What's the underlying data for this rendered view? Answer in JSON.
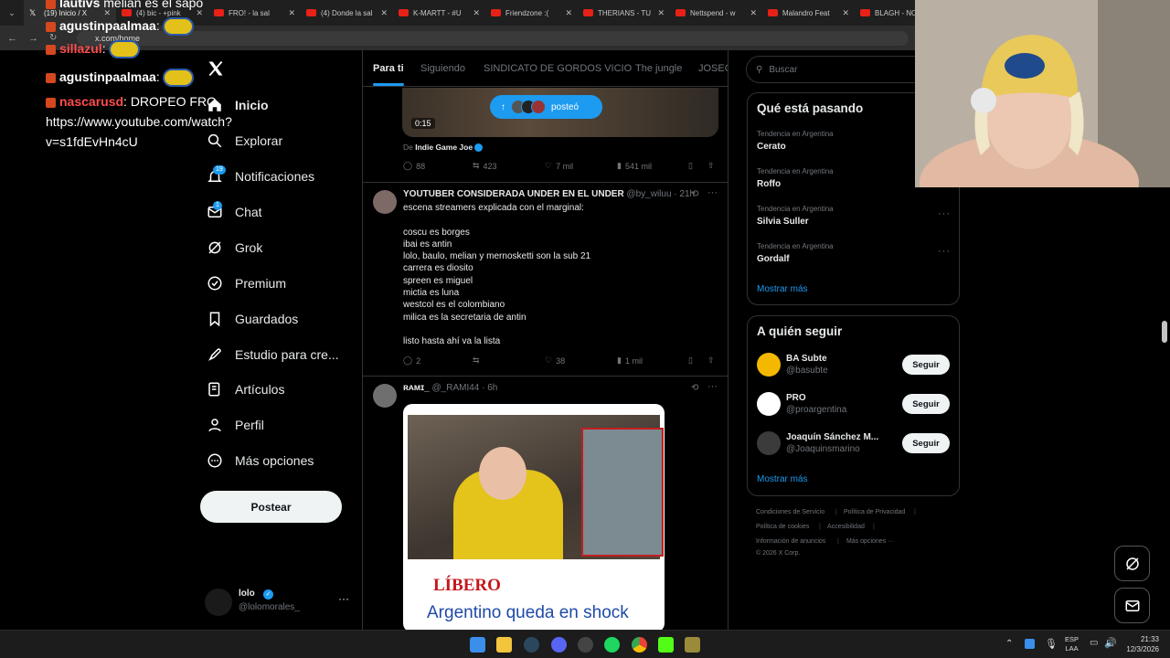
{
  "browser": {
    "tabs": [
      {
        "label": "(19) Inicio / X",
        "active": true,
        "favicon": "x-icon"
      },
      {
        "label": "(4) bic - +pink",
        "favicon": "youtube-icon"
      },
      {
        "label": "FRO! - la sal",
        "favicon": "youtube-icon"
      },
      {
        "label": "(4) Donde la sal",
        "favicon": "youtube-icon"
      },
      {
        "label": "K-MARTT - #U",
        "favicon": "youtube-icon"
      },
      {
        "label": "Friendzone :(",
        "favicon": "youtube-icon"
      },
      {
        "label": "THERIANS - TU",
        "favicon": "youtube-icon"
      },
      {
        "label": "Nettspend - w",
        "favicon": "youtube-icon"
      },
      {
        "label": "Malandro Feat",
        "favicon": "youtube-icon"
      },
      {
        "label": "BLAGH - NO",
        "favicon": "youtube-icon"
      }
    ],
    "url": "x.com/home"
  },
  "chat": [
    {
      "user": "lautivs",
      "text": " melian es el sapo",
      "color": "#ffffff"
    },
    {
      "user": "agustinpaalmaa",
      "text": ":",
      "color": "#ffffff",
      "emote": true
    },
    {
      "user": "sillazul",
      "text": ":",
      "color": "#ff4d4d",
      "emote": true
    },
    {
      "user": "agustinpaalmaa",
      "text": ":",
      "color": "#ffffff",
      "emote": true
    },
    {
      "user": "nascarusd",
      "text": ": DROPEO FRO https://www.youtube.com/watch?v=s1fdEvHn4cU",
      "color": "#ff4d4d"
    }
  ],
  "sidebar": {
    "items": [
      {
        "label": "Inicio",
        "icon": "home-icon",
        "bold": true
      },
      {
        "label": "Explorar",
        "icon": "search-icon"
      },
      {
        "label": "Notificaciones",
        "icon": "bell-icon",
        "badge": "19"
      },
      {
        "label": "Chat",
        "icon": "mail-icon",
        "badge": "1"
      },
      {
        "label": "Grok",
        "icon": "grok-icon"
      },
      {
        "label": "Premium",
        "icon": "premium-icon"
      },
      {
        "label": "Guardados",
        "icon": "bookmark-icon"
      },
      {
        "label": "Estudio para cre...",
        "icon": "rocket-icon"
      },
      {
        "label": "Artículos",
        "icon": "article-icon"
      },
      {
        "label": "Perfil",
        "icon": "person-icon"
      },
      {
        "label": "Más opciones",
        "icon": "more-circle-icon"
      }
    ],
    "post_label": "Postear",
    "account": {
      "name": "lolo",
      "handle": "@lolomorales_"
    }
  },
  "feed": {
    "tabs": [
      "Para ti",
      "Siguiendo",
      "SINDICATO DE GORDOS VICIO",
      "The jungle",
      "JOSEO"
    ],
    "tweet1": {
      "duration": "0:15",
      "posted_label": "posteó",
      "from_prefix": "De",
      "from_name": "Indie Game Joe",
      "replies": "88",
      "retweets": "423",
      "likes": "7 mil",
      "views": "541 mil"
    },
    "tweet2": {
      "name": "YOUTUBER CONSIDERADA UNDER EN EL UNDER",
      "handle": "@by_wiluu · 21h",
      "lines": [
        "escena streamers explicada con el marginal:",
        "",
        "coscu es borges",
        "ibai es antin",
        "lolo, baulo, melian y mernosketti son la sub 21",
        "carrera es diosito",
        "spreen es miguel",
        "mictia es luna",
        "westcol es el colombiano",
        "milica es la secretaria de antin",
        "",
        "listo hasta ahí va la lista"
      ],
      "replies": "2",
      "retweets": "",
      "likes": "38",
      "views": "1 mil"
    },
    "tweet3": {
      "name": "ʀᴀᴍɪ_",
      "handle": "@_RAMI44 · 6h",
      "logo": "LÍBERO",
      "headline": "Argentino queda en shock"
    }
  },
  "right": {
    "search_placeholder": "Buscar",
    "trends_title": "Qué está pasando",
    "trends": [
      {
        "category": "Tendencia en Argentina",
        "name": "Cerato"
      },
      {
        "category": "Tendencia en Argentina",
        "name": "Roffo"
      },
      {
        "category": "Tendencia en Argentina",
        "name": "Silvia Suller"
      },
      {
        "category": "Tendencia en Argentina",
        "name": "Gordalf"
      }
    ],
    "show_more": "Mostrar más",
    "follow_title": "A quién seguir",
    "follows": [
      {
        "name": "BA Subte",
        "handle": "@basubte",
        "button": "Seguir",
        "color": "#f5b800"
      },
      {
        "name": "PRO",
        "handle": "@proargentina",
        "button": "Seguir",
        "color": "#ffffff"
      },
      {
        "name": "Joaquín Sánchez M...",
        "handle": "@Joaquinsmarino",
        "button": "Seguir",
        "color": "#3b3b3b"
      }
    ],
    "footer": [
      "Condiciones de Servicio",
      "Política de Privacidad",
      "Política de cookies",
      "Accesibilidad",
      "Información de anuncios",
      "Más opciones ···",
      "© 2026 X Corp."
    ]
  },
  "taskbar": {
    "lang": "ESP",
    "lang2": "LAA",
    "time": "21:33",
    "date": "12/3/2026"
  }
}
